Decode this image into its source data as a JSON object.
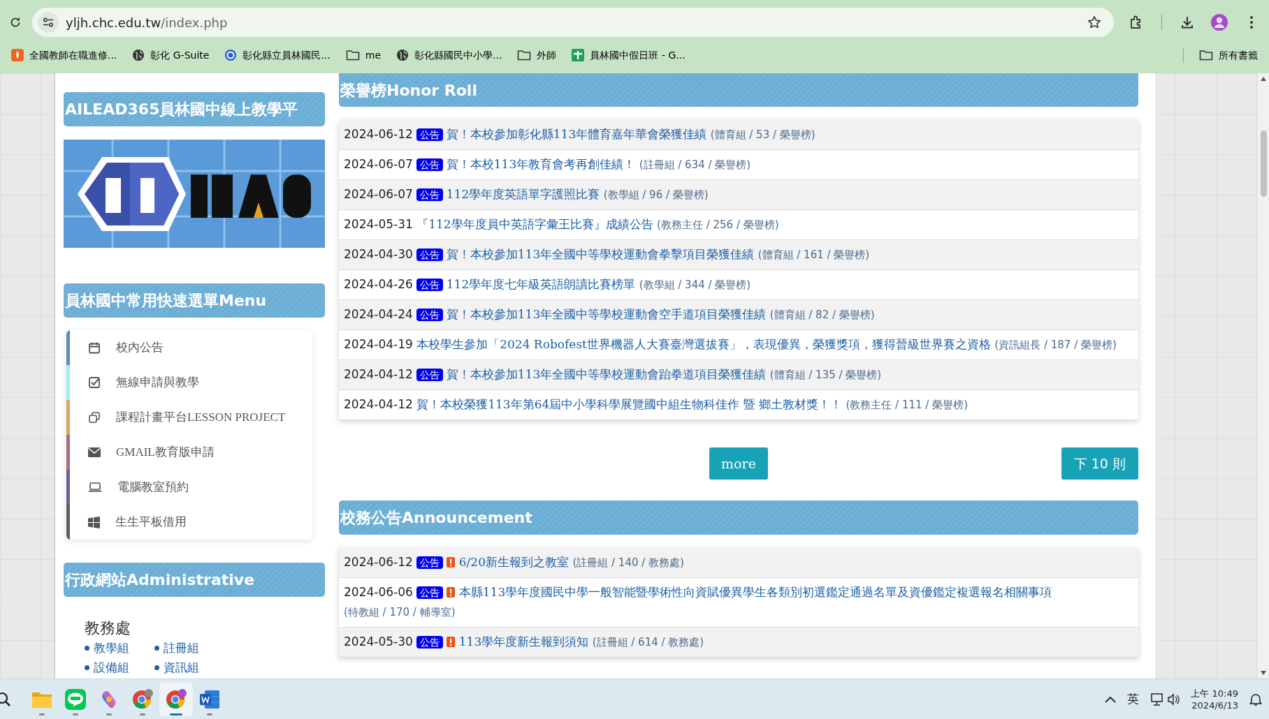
{
  "browser": {
    "url": "yljh.chc.edu.tw/index.php",
    "bookmarks": [
      {
        "label": "全國教師在職進修..."
      },
      {
        "label": "彰化 G-Suite"
      },
      {
        "label": "彰化縣立員林國民..."
      },
      {
        "label": "me"
      },
      {
        "label": "彰化縣國民中小學..."
      },
      {
        "label": "外師"
      },
      {
        "label": "員林國中假日班 - G..."
      }
    ],
    "all_bookmarks": "所有書籤"
  },
  "sidebar": {
    "platform_title": "AILEAD365員林國中線上教學平",
    "menu_title": "員林國中常用快速選單Menu",
    "menu_items": [
      {
        "label": "校內公告",
        "color": "#5b8db8"
      },
      {
        "label": "無線申請與教學",
        "color": "#9ef0ea"
      },
      {
        "label": "課程計畫平台LESSON PROJECT",
        "color": "#d6a862"
      },
      {
        "label": "GMAIL教育版申請",
        "color": "#a86c88"
      },
      {
        "label": "電腦教室預約",
        "color": "#6c5e98"
      },
      {
        "label": "生生平板借用",
        "color": "#5e5e5e"
      }
    ],
    "admin_title": "行政網站Administrative",
    "admin_groups": [
      {
        "name": "教務處",
        "links": [
          "教學組",
          "註冊組",
          "設備組",
          "資訊組"
        ]
      }
    ]
  },
  "honor_roll": {
    "title": "榮譽榜Honor Roll",
    "posts": [
      {
        "date": "2024-06-12",
        "badge": "公告",
        "title": "賀！本校參加彰化縣113年體育嘉年華會榮獲佳績",
        "meta": "(體育組 / 53 / 榮譽榜)"
      },
      {
        "date": "2024-06-07",
        "badge": "公告",
        "title": "賀！本校113年教育會考再創佳績！",
        "meta": "(註冊組 / 634 / 榮譽榜)"
      },
      {
        "date": "2024-06-07",
        "badge": "公告",
        "title": "112學年度英語單字護照比賽",
        "meta": "(教學組 / 96 / 榮譽榜)"
      },
      {
        "date": "2024-05-31",
        "title": "『112學年度員中英語字彙王比賽』成績公告",
        "meta": "(教務主任 / 256 / 榮譽榜)"
      },
      {
        "date": "2024-04-30",
        "badge": "公告",
        "title": "賀！本校參加113年全國中等學校運動會拳擊項目榮獲佳績",
        "meta": "(體育組 / 161 / 榮譽榜)"
      },
      {
        "date": "2024-04-26",
        "badge": "公告",
        "title": "112學年度七年級英語朗讀比賽榜單",
        "meta": "(教學組 / 344 / 榮譽榜)"
      },
      {
        "date": "2024-04-24",
        "badge": "公告",
        "title": "賀！本校參加113年全國中等學校運動會空手道項目榮獲佳績",
        "meta": "(體育組 / 82 / 榮譽榜)"
      },
      {
        "date": "2024-04-19",
        "title": "本校學生參加「2024 Robofest世界機器人大賽臺灣選拔賽」，表現優異，榮獲獎項，獲得晉級世界賽之資格",
        "meta": "(資訊組長 / 187 / 榮譽榜)"
      },
      {
        "date": "2024-04-12",
        "badge": "公告",
        "title": "賀！本校參加113年全國中等學校運動會跆拳道項目榮獲佳績",
        "meta": "(體育組 / 135 / 榮譽榜)"
      },
      {
        "date": "2024-04-12",
        "title": "賀！本校榮獲113年第64屆中小學科學展覽國中組生物科佳作 暨 鄉土教材獎！！",
        "meta": "(教務主任 / 111 / 榮譽榜)"
      }
    ],
    "more_button": "more",
    "next_button": "下 10 則"
  },
  "announcements": {
    "title": "校務公告Announcement",
    "posts": [
      {
        "date": "2024-06-12",
        "badge": "公告",
        "important": true,
        "title": "6/20新生報到之教室",
        "meta": "(註冊組 / 140 / 教務處)"
      },
      {
        "date": "2024-06-06",
        "badge": "公告",
        "important": true,
        "title": "本縣113學年度國民中學一般智能暨學術性向資賦優異學生各類別初選鑑定通過名單及資優鑑定複選報名相關事項",
        "meta": "(特教組 / 170 / 輔導室)"
      },
      {
        "date": "2024-05-30",
        "badge": "公告",
        "important": true,
        "title": "113學年度新生報到須知",
        "meta": "(註冊組 / 614 / 教務處)"
      }
    ]
  },
  "taskbar": {
    "input_indicator": "英",
    "time": "上午 10:49",
    "date": "2024/6/13"
  }
}
